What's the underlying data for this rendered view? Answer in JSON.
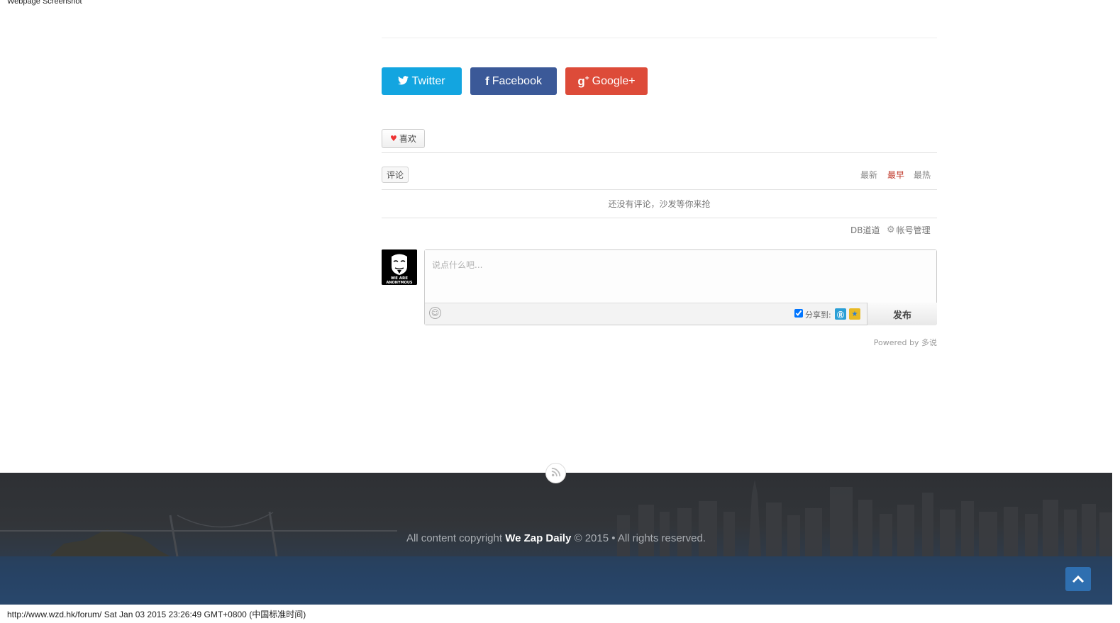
{
  "page_label": "Webpage Screenshot",
  "share": {
    "twitter": "Twitter",
    "facebook": "Facebook",
    "google": "Google+"
  },
  "like": {
    "label": "喜欢"
  },
  "comments": {
    "tab": "评论",
    "sort": [
      "最新",
      "最早",
      "最热"
    ],
    "active_sort": "最早",
    "empty": "还没有评论，沙发等你来抢",
    "account_left": "DB道道",
    "account_manage": "帐号管理",
    "placeholder": "说点什么吧...",
    "share_to": "分享到:",
    "publish": "发布",
    "powered": "Powered by 多说"
  },
  "avatar": {
    "line1": "WE ARE",
    "line2": "ANONYMOUS"
  },
  "footer": {
    "prefix": "All content copyright",
    "brand": "We Zap Daily",
    "suffix": "© 2015 • All rights reserved."
  },
  "status_bar": "http://www.wzd.hk/forum/ Sat Jan 03 2015 23:26:49 GMT+0800 (中国标准时间)",
  "colors": {
    "twitter": "#13a5e0",
    "facebook": "#3b5998",
    "google": "#dd4b39",
    "active_sort": "#c0392b",
    "to_top": "#2f6fb0"
  },
  "icons": [
    "twitter-icon",
    "facebook-icon",
    "google-plus-icon",
    "heart-icon",
    "gear-icon",
    "emoji-icon",
    "weibo-icon",
    "qzone-icon",
    "rss-icon",
    "chevron-up-icon"
  ]
}
